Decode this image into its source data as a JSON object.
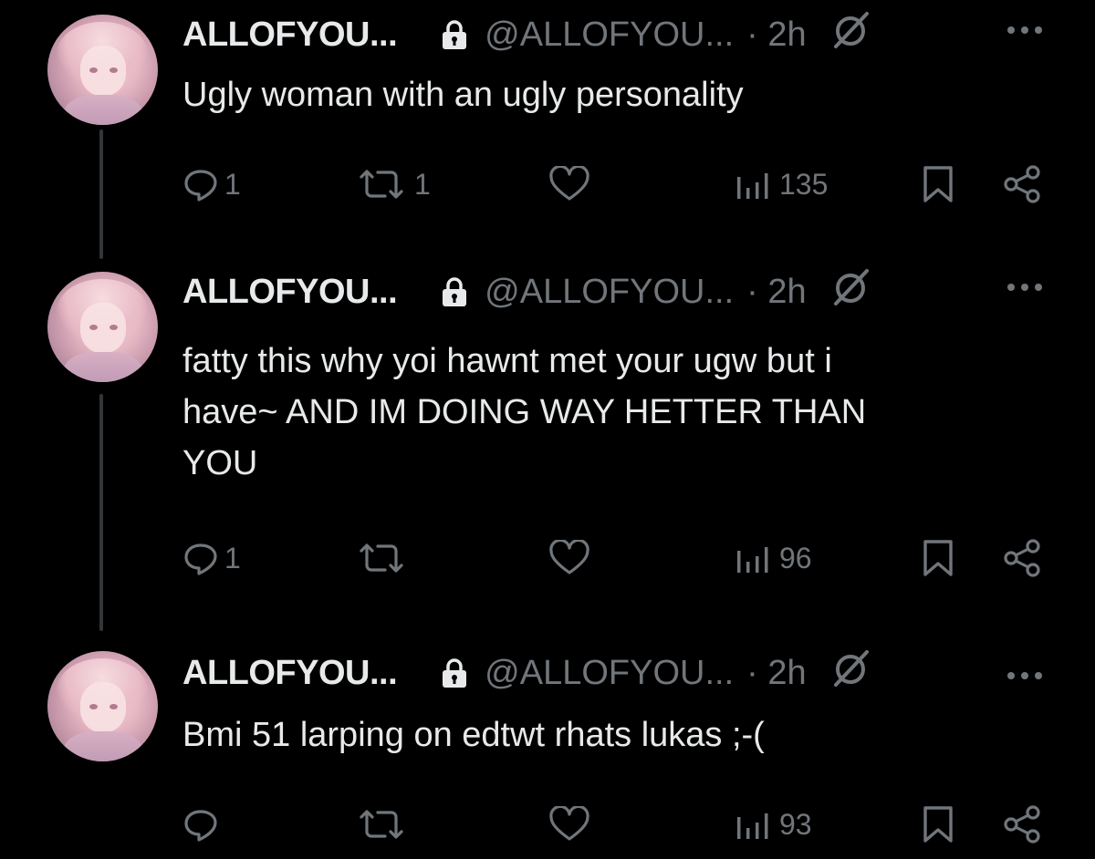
{
  "tweets": [
    {
      "name": "ALLOFYOU...",
      "handle": "@ALLOFYOU...",
      "time": "· 2h",
      "text": "Ugly woman with an ugly personality",
      "replies": "1",
      "reposts": "1",
      "likes": "",
      "views": "135"
    },
    {
      "name": "ALLOFYOU...",
      "handle": "@ALLOFYOU...",
      "time": "· 2h",
      "text_lines": [
        "fatty this why yoi hawnt met your ugw but i",
        "have~ AND IM DOING WAY HETTER THAN",
        "YOU"
      ],
      "replies": "1",
      "reposts": "",
      "likes": "",
      "views": "96"
    },
    {
      "name": "ALLOFYOU...",
      "handle": "@ALLOFYOU...",
      "time": "· 2h",
      "text": "Bmi 51 larping on edtwt rhats lukas ;-(",
      "replies": "",
      "reposts": "",
      "likes": "",
      "views": "93"
    }
  ],
  "colors": {
    "background": "#000000",
    "text": "#e7e9ea",
    "muted": "#71767b",
    "thread_line": "#333639"
  },
  "icons": [
    "lock-icon",
    "no-entry-badge-icon",
    "more-icon",
    "reply-icon",
    "repost-icon",
    "like-icon",
    "views-icon",
    "bookmark-icon",
    "share-icon"
  ]
}
